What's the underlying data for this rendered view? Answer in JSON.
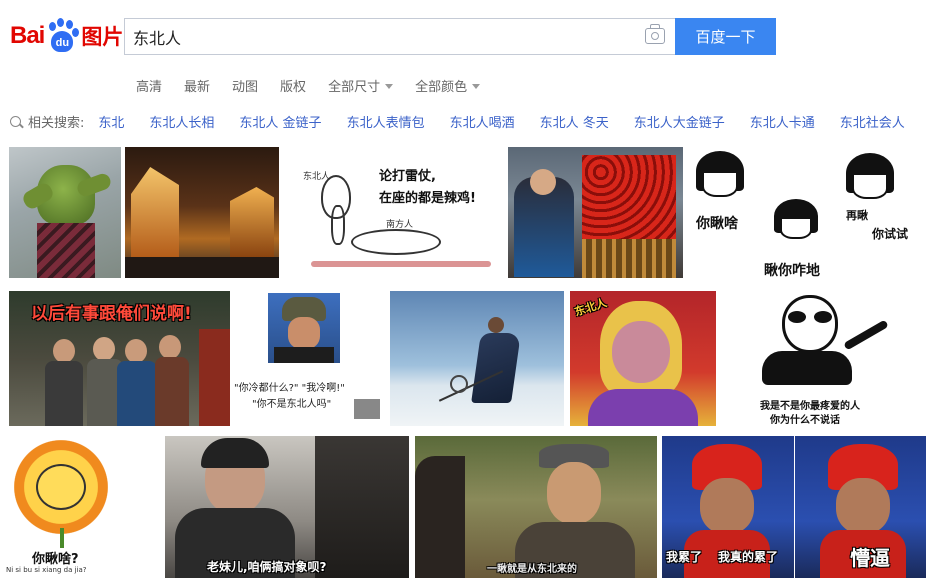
{
  "logo": {
    "bai": "Bai",
    "du": "du",
    "tupian": "图片"
  },
  "search": {
    "value": "东北人",
    "button": "百度一下"
  },
  "filters": [
    "高清",
    "最新",
    "动图",
    "版权",
    "全部尺寸",
    "全部颜色"
  ],
  "related": {
    "label": "相关搜索:",
    "items": [
      "东北",
      "东北人长相",
      "东北人 金链子",
      "东北人表情包",
      "东北人喝酒",
      "东北人 冬天",
      "东北人大金链子",
      "东北人卡通",
      "东北社会人"
    ]
  },
  "images": {
    "rabbit": {
      "top": "论打雷仗,",
      "bottom": "在座的都是辣鸡!",
      "tag1": "东北人",
      "tag2": "南方人"
    },
    "panda_faces": {
      "a": "你瞅啥",
      "b": "瞅你咋地",
      "c": "再瞅",
      "d": "你试试"
    },
    "group": {
      "caption": "以后有事跟俺们说啊!"
    },
    "hat": {
      "line1": "\"你冷都什么?\"  \"我冷啊!\"",
      "line2": "\"你不是东北人吗\""
    },
    "aunt": {
      "badge": "东北人"
    },
    "panda_pointer": {
      "line1": "我是不是你最疼爱的人",
      "line2": "你为什么不说话"
    },
    "sunflower": {
      "caption": "你瞅啥?",
      "sub": "Ni si bu si xiang da jia?"
    },
    "man": {
      "caption": "老妹儿,咱俩搞对象呗?"
    },
    "elder": {
      "caption": "一瞅就是从东北来的"
    },
    "red_hat": {
      "left": "我累了",
      "mid": "我真的累了",
      "right": "懵逼"
    }
  }
}
